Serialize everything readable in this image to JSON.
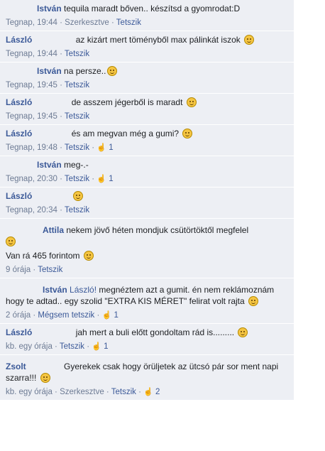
{
  "comments": [
    {
      "author": "István",
      "text": "tequila maradt bőven.. készítsd a gyomrodat:D",
      "emoji": false,
      "meta": {
        "time": "Tegnap, 19:44",
        "items": [
          "Szerkesztve",
          "Tetszik"
        ],
        "likes": ""
      }
    },
    {
      "author": "László",
      "text": "az kizárt mert töményből max pálinkát iszok",
      "emoji": true,
      "meta": {
        "time": "Tegnap, 19:44",
        "items": [
          "Tetszik"
        ],
        "likes": ""
      }
    },
    {
      "author": "István",
      "text": "na persze..",
      "emoji": true,
      "meta": {
        "time": "Tegnap, 19:45",
        "items": [
          "Tetszik"
        ],
        "likes": ""
      }
    },
    {
      "author": "László",
      "text": "de asszem jégerből is maradt",
      "emoji": true,
      "meta": {
        "time": "Tegnap, 19:45",
        "items": [
          "Tetszik"
        ],
        "likes": ""
      }
    },
    {
      "author": "László",
      "text": "és am megvan még a gumi?",
      "emoji": true,
      "meta": {
        "time": "Tegnap, 19:48",
        "items": [
          "Tetszik"
        ],
        "likes": "1"
      }
    },
    {
      "author": "István",
      "text": "meg-.-",
      "emoji": false,
      "meta": {
        "time": "Tegnap, 20:30",
        "items": [
          "Tetszik"
        ],
        "likes": "1"
      }
    },
    {
      "author": "László",
      "text": "",
      "emoji": true,
      "meta": {
        "time": "Tegnap, 20:34",
        "items": [
          "Tetszik"
        ],
        "likes": ""
      }
    },
    {
      "author": "Attila",
      "text": "nekem jövő héten mondjuk csütörtöktől megfelel",
      "emoji": true,
      "text2": "Van rá 465 forintom",
      "emoji2": true,
      "meta": {
        "time": "9 órája",
        "items": [
          "Tetszik"
        ],
        "likes": ""
      }
    },
    {
      "author": "István",
      "mention": "László!",
      "text": "megnéztem azt a gumit. én nem reklámoznám hogy te adtad.. egy szolid \"EXTRA KIS MÉRET\" felirat volt rajta",
      "emoji": true,
      "meta": {
        "time": "2 órája",
        "items": [
          "Mégsem tetszik"
        ],
        "likes": "1"
      }
    },
    {
      "author": "László",
      "text": "jah mert a buli előtt gondoltam rád is.........",
      "emoji": true,
      "meta": {
        "time": "kb. egy órája",
        "items": [
          "Tetszik"
        ],
        "likes": "1"
      }
    },
    {
      "author": "Zsolt",
      "text": "Gyerekek csak hogy örüljetek az ütcsó pár sor ment napi szarra!!!",
      "emoji": true,
      "meta": {
        "time": "kb. egy órája",
        "items": [
          "Szerkesztve",
          "Tetszik"
        ],
        "likes": "2"
      }
    }
  ]
}
